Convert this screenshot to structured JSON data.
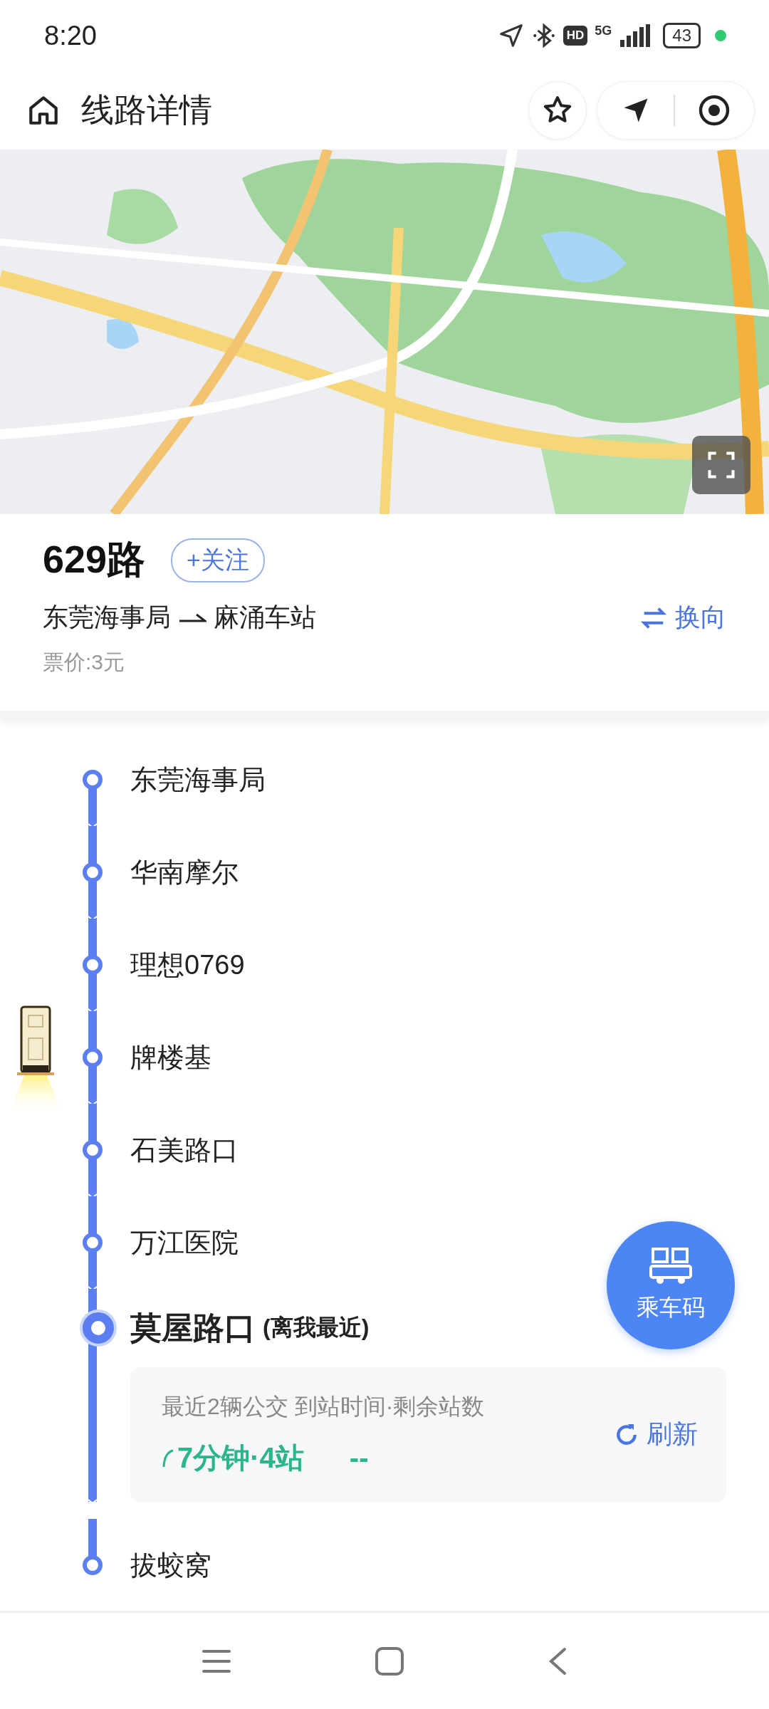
{
  "status_bar": {
    "time": "8:20",
    "hd": "HD",
    "network": "5G",
    "battery": "43"
  },
  "header": {
    "title": "线路详情"
  },
  "route": {
    "name": "629路",
    "follow_label": "+关注",
    "from": "东莞海事局",
    "to": "麻涌车站",
    "reverse_label": "换向",
    "fare": "票价:3元"
  },
  "stations": [
    {
      "name": "东莞海事局",
      "kind": "stop",
      "bus": false
    },
    {
      "name": "华南摩尔",
      "kind": "stop",
      "bus": false
    },
    {
      "name": "理想0769",
      "kind": "stop",
      "bus": false
    },
    {
      "name": "牌楼基",
      "kind": "stop",
      "bus": true
    },
    {
      "name": "石美路口",
      "kind": "stop",
      "bus": false
    },
    {
      "name": "万江医院",
      "kind": "stop",
      "bus": false
    },
    {
      "name": "莫屋路口",
      "kind": "current",
      "note": "(离我最近)",
      "bus": false,
      "arrival": {
        "caption": "最近2辆公交 到站时间·剩余站数",
        "first": "7分钟·4站",
        "second": "--",
        "refresh_label": "刷新"
      }
    },
    {
      "name": "拔蛟窝",
      "kind": "stop",
      "bus": false
    }
  ],
  "ride_code": {
    "label": "乘车码"
  }
}
